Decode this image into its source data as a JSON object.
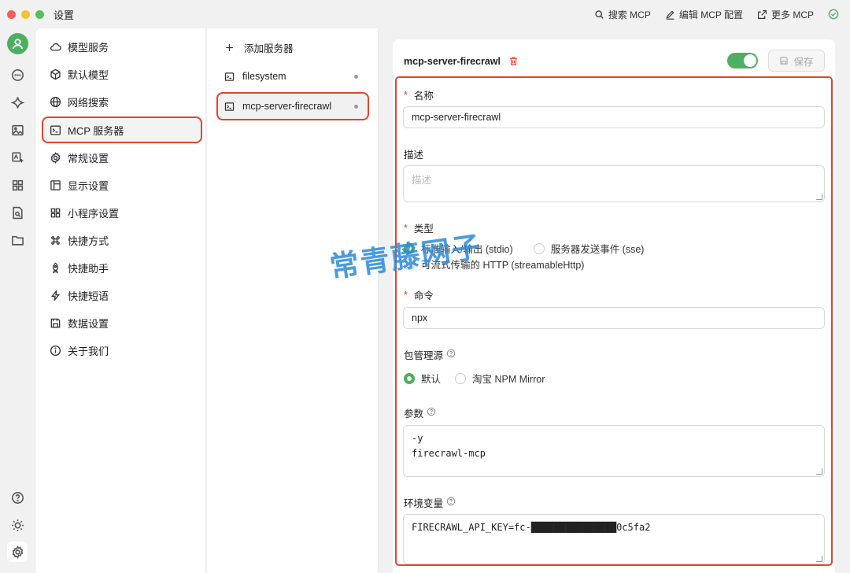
{
  "window": {
    "title": "设置",
    "actions": [
      {
        "icon": "search-icon",
        "label": "搜索 MCP"
      },
      {
        "icon": "edit-icon",
        "label": "编辑 MCP 配置"
      },
      {
        "icon": "external-link-icon",
        "label": "更多 MCP"
      }
    ]
  },
  "rail": {
    "icons": [
      "avatar-icon",
      "chat-icon",
      "sparkle-icon",
      "image-icon",
      "image-translate-icon",
      "apps-icon",
      "document-search-icon",
      "folder-icon",
      "help-icon",
      "theme-icon",
      "settings-icon"
    ]
  },
  "menu": {
    "items": [
      {
        "icon": "cloud-icon",
        "label": "模型服务"
      },
      {
        "icon": "cube-icon",
        "label": "默认模型"
      },
      {
        "icon": "globe-icon",
        "label": "网络搜索"
      },
      {
        "icon": "terminal-icon",
        "label": "MCP 服务器"
      },
      {
        "icon": "gear-icon",
        "label": "常规设置"
      },
      {
        "icon": "layout-icon",
        "label": "显示设置"
      },
      {
        "icon": "grid-icon",
        "label": "小程序设置"
      },
      {
        "icon": "command-icon",
        "label": "快捷方式"
      },
      {
        "icon": "rocket-icon",
        "label": "快捷助手"
      },
      {
        "icon": "zap-icon",
        "label": "快捷短语"
      },
      {
        "icon": "save-icon",
        "label": "数据设置"
      },
      {
        "icon": "info-icon",
        "label": "关于我们"
      }
    ],
    "active_index": 3
  },
  "servers": {
    "add_label": "添加服务器",
    "items": [
      {
        "icon": "terminal-icon",
        "name": "filesystem"
      },
      {
        "icon": "terminal-icon",
        "name": "mcp-server-firecrawl"
      }
    ],
    "active_index": 1
  },
  "detail": {
    "title": "mcp-server-firecrawl",
    "enabled": true,
    "save_label": "保存",
    "accent_color": "#4caf62",
    "highlight_color": "#e0452e",
    "name_label": "名称",
    "name_value": "mcp-server-firecrawl",
    "desc_label": "描述",
    "desc_placeholder": "描述",
    "type_label": "类型",
    "type_options": [
      "标准输入/输出 (stdio)",
      "服务器发送事件 (sse)",
      "可流式传输的 HTTP (streamableHttp)"
    ],
    "type_selected": 0,
    "command_label": "命令",
    "command_value": "npx",
    "registry_label": "包管理源",
    "registry_options": [
      "默认",
      "淘宝 NPM Mirror"
    ],
    "registry_selected": 0,
    "args_label": "参数",
    "args_value": "-y\nfirecrawl-mcp",
    "env_label": "环境变量",
    "env_value": "FIRECRAWL_API_KEY=fc-███████████████0c5fa2"
  },
  "watermark": "常青藤网子"
}
